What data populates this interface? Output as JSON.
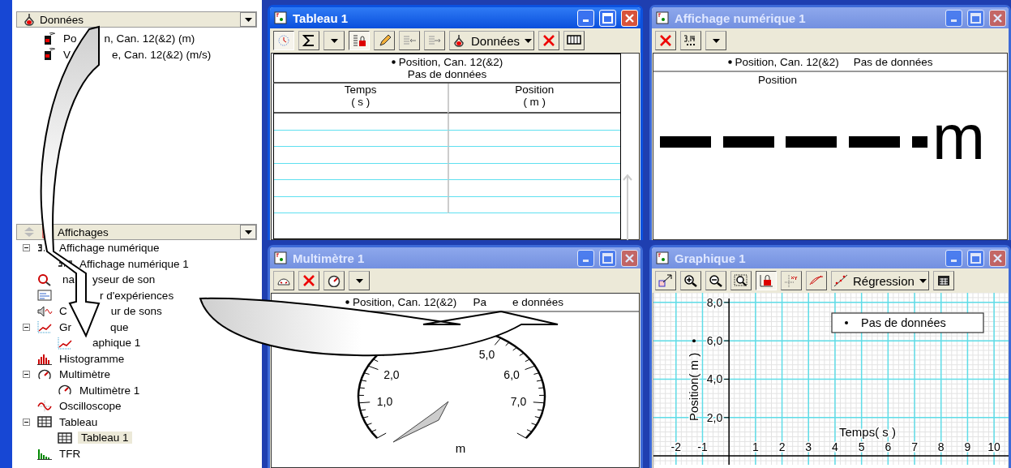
{
  "data_panel": {
    "title": "Données",
    "items": [
      {
        "label": [
          "Po",
          "n, Can. 12(&2) (m)"
        ]
      },
      {
        "label": [
          "V",
          "e, Can. 12(&2) (m/s)"
        ]
      }
    ]
  },
  "displays_panel": {
    "title": "Affichages",
    "items": [
      {
        "label": [
          "Affichage numérique"
        ],
        "kind": "digits",
        "expanded": true,
        "selected": false,
        "children": [
          {
            "label": [
              "Affichage numérique 1"
            ],
            "kind": "digits",
            "selected": false
          }
        ]
      },
      {
        "label": [
          "na",
          "yseur de son"
        ],
        "kind": "sound",
        "selected": false
      },
      {
        "label": [
          "r d'expériences"
        ],
        "kind": "workbook",
        "selected": false
      },
      {
        "label": [
          "C",
          "ur de sons"
        ],
        "kind": "speaker",
        "selected": false
      },
      {
        "label": [
          "Gr",
          "que"
        ],
        "kind": "graph",
        "expanded": true,
        "selected": false,
        "children": [
          {
            "label": [
              "aphique 1"
            ],
            "kind": "graph",
            "selected": false
          }
        ]
      },
      {
        "label": [
          "Histogramme"
        ],
        "kind": "histogram",
        "selected": false
      },
      {
        "label": [
          "Multimètre"
        ],
        "kind": "meter",
        "expanded": true,
        "selected": false,
        "children": [
          {
            "label": [
              "Multimètre 1"
            ],
            "kind": "meter",
            "selected": false
          }
        ]
      },
      {
        "label": [
          "Oscilloscope"
        ],
        "kind": "scope",
        "selected": false
      },
      {
        "label": [
          "Tableau"
        ],
        "kind": "table",
        "expanded": true,
        "selected": false,
        "children": [
          {
            "label": [
              "Tableau 1"
            ],
            "kind": "table",
            "selected": true
          }
        ]
      },
      {
        "label": [
          "TFR"
        ],
        "kind": "fft",
        "selected": false
      }
    ]
  },
  "table_window": {
    "title": "Tableau 1",
    "active": true,
    "source_dropdown": "Données",
    "series": "Position, Can. 12(&2)",
    "status": "Pas de données",
    "columns": [
      {
        "name": "Temps",
        "unit": "( s )"
      },
      {
        "name": "Position",
        "unit": "( m )"
      }
    ]
  },
  "digits_window": {
    "title": "Affichage numérique 1",
    "active": false,
    "series": "Position, Can. 12(&2)",
    "status": "Pas de données",
    "quantity": "Position",
    "unit": "m"
  },
  "meter_window": {
    "title": "Multimètre 1",
    "active": false,
    "series": "Position, Can. 12(&2)",
    "status": [
      "Pa",
      "e données"
    ],
    "scale_labels": [
      "1,0",
      "2,0",
      "5,0",
      "6,0",
      "7,0"
    ],
    "unit": "m"
  },
  "graph_window": {
    "title": "Graphique 1",
    "active": false,
    "fit_dropdown": "Régression",
    "chart_data": {
      "type": "scatter",
      "xlabel": "Temps( s )",
      "ylabel": "Position( m )",
      "grid": true,
      "ylim": [
        -0.46,
        8.5
      ],
      "categories": [
        "-2",
        "-1",
        "1",
        "2",
        "3",
        "4",
        "5",
        "6",
        "7",
        "8",
        "9",
        "10"
      ],
      "yticks": [
        {
          "value": 2,
          "label": "2,0"
        },
        {
          "value": 4,
          "label": "4,0"
        },
        {
          "value": 6,
          "label": "6,0"
        },
        {
          "value": 8,
          "label": "8,0"
        }
      ],
      "series": [
        {
          "name": "Pas de données",
          "values": [
            null,
            null,
            null,
            null,
            null,
            null,
            null,
            null,
            null,
            null,
            null,
            null
          ]
        }
      ]
    }
  }
}
